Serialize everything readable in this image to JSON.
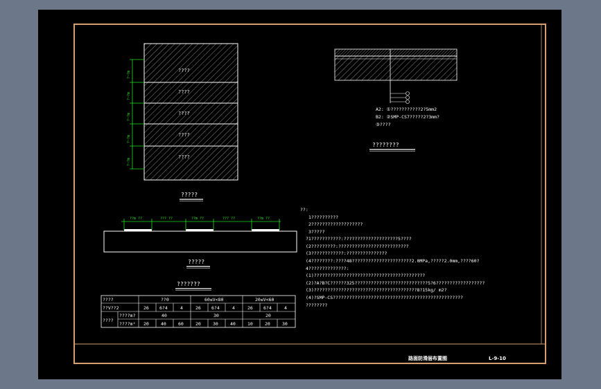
{
  "colors": {
    "background": "#6c778a",
    "canvas": "#000000",
    "frame": "#d4a070",
    "line": "#ffffff",
    "dimension": "#22e022"
  },
  "plan": {
    "bands": [
      "????",
      "????",
      "????",
      "????",
      "????"
    ],
    "dims": [
      "?~?m",
      "?~?m",
      "?~?m",
      "?~?m",
      "?~?m"
    ],
    "title": "?????"
  },
  "section": {
    "segments": [
      "??m ??",
      "??? ??",
      "??m ??",
      "??? ??",
      "??m ??"
    ],
    "title": "?????"
  },
  "table": {
    "title": "???????",
    "row1": [
      "????",
      "??0",
      "60≤V<80",
      "20≤V<60"
    ],
    "row2": [
      "??V??2",
      "26",
      "6?4",
      "4",
      "26",
      "6?4",
      "4",
      "26",
      "6?4",
      "4"
    ],
    "row3_label": "????",
    "row3a_label": "????m?",
    "row3a_values": [
      "40",
      "30",
      "20"
    ],
    "row3b_label": "????m²",
    "row3b_values": [
      "20",
      "40",
      "60",
      "20",
      "30",
      "40",
      "10",
      "20",
      "30"
    ]
  },
  "detail": {
    "legend": [
      "A2: ①???????????2?5mm2",
      "B2: ②SMP-CS7?????2?3mm?",
      "③????"
    ],
    "title": "????????"
  },
  "notes": {
    "heading": "??:",
    "lines": [
      "1??????????",
      "2???????????????????",
      "3?????",
      "?1???????????:????????????????????5????",
      "(2?????????:??????????????????????????",
      "(3????????????:???????????????",
      "(4????????:????48??????????????????????2.0MPa,?????2.0mm,????60?",
      "4??????????????:",
      "(1)?????????????????????????????????????????",
      "(2)?A?B?C??????325???????????????????????????5?6??????????????????",
      "(3)??????????????????????????????????????8?15kg/ m2?",
      "(4)?SMP-CS????????????????????????????????????????????????",
      "????????"
    ]
  },
  "title_block": {
    "drawing_name": "路面防滑层布置图",
    "drawing_no": "L-9-10"
  }
}
